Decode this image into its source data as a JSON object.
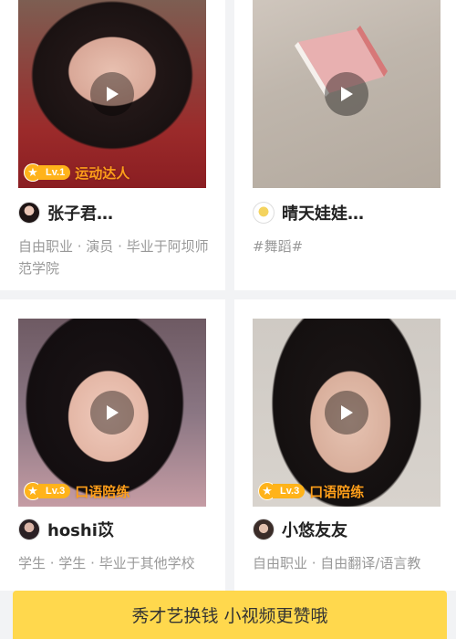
{
  "cards": [
    {
      "badge_level": "Lv.1",
      "badge_tag": "运动达人",
      "name": "张子君…",
      "description": "自由职业 · 演员 · 毕业于阿坝师范学院",
      "photo": "woman-sunglasses-red-shirt"
    },
    {
      "name": "晴天娃娃…",
      "description": "#舞蹈#",
      "photo": "folded-banknote-on-wood"
    },
    {
      "badge_level": "Lv.3",
      "badge_tag": "口语陪练",
      "name": "hoshi苡",
      "description": "学生 · 学生 · 毕业于其他学校",
      "photo": "young-woman-selfie"
    },
    {
      "badge_level": "Lv.3",
      "badge_tag": "口语陪练",
      "name": "小悠友友",
      "description": "自由职业 · 自由翻译/语言教",
      "photo": "woman-long-hair-smiling"
    }
  ],
  "bottom_banner": "秀才艺换钱 小视频更赞哦",
  "colors": {
    "badge": "#ffb31a",
    "badge_text": "#ff9f1a",
    "banner": "#ffd84d"
  }
}
